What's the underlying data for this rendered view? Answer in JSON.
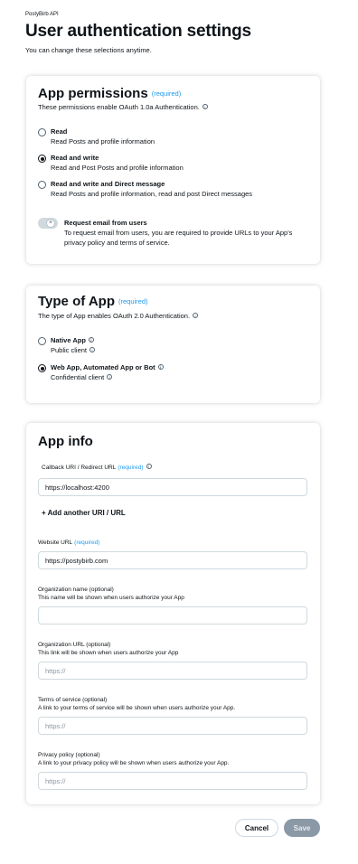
{
  "header": {
    "app_name": "PostyBirb API",
    "title": "User authentication settings",
    "subtitle": "You can change these selections anytime."
  },
  "permissions": {
    "title": "App permissions",
    "required": "(required)",
    "description": "These permissions enable OAuth 1.0a Authentication.",
    "options": [
      {
        "label": "Read",
        "sub": "Read Posts and profile information",
        "checked": false
      },
      {
        "label": "Read and write",
        "sub": "Read and Post Posts and profile information",
        "checked": true
      },
      {
        "label": "Read and write and Direct message",
        "sub": "Read Posts and profile information, read and post Direct messages",
        "checked": false
      }
    ],
    "email_toggle": {
      "label": "Request email from users",
      "description": "To request email from users, you are required to provide URLs to your App's privacy policy and terms of service.",
      "on": false
    }
  },
  "app_type": {
    "title": "Type of App",
    "required": "(required)",
    "description": "The type of App enables OAuth 2.0 Authentication.",
    "options": [
      {
        "label": "Native App",
        "sub": "Public client",
        "checked": false
      },
      {
        "label": "Web App, Automated App or Bot",
        "sub": "Confidential client",
        "checked": true
      }
    ]
  },
  "app_info": {
    "title": "App info",
    "callback": {
      "label": "Callback URI / Redirect URL",
      "required": "(required)",
      "value": "https://localhost:4200"
    },
    "add_uri": "+ Add another URI / URL",
    "website": {
      "label": "Website URL",
      "required": "(required)",
      "value": "https://postybirb.com"
    },
    "org_name": {
      "label": "Organization name (optional)",
      "hint": "This name will be shown when users authorize your App",
      "value": ""
    },
    "org_url": {
      "label": "Organization URL (optional)",
      "hint": "This link will be shown when users authorize your App",
      "placeholder": "https://"
    },
    "terms": {
      "label": "Terms of service (optional)",
      "hint": "A link to your terms of service will be shown when users authorize your App.",
      "placeholder": "https://"
    },
    "privacy": {
      "label": "Privacy policy (optional)",
      "hint": "A link to your privacy policy will be shown when users authorize your App.",
      "placeholder": "https://"
    }
  },
  "footer": {
    "cancel": "Cancel",
    "save": "Save"
  },
  "colors": {
    "accent": "#1d9bf0",
    "text": "#0f1419",
    "save_disabled": "#8b98a5"
  }
}
